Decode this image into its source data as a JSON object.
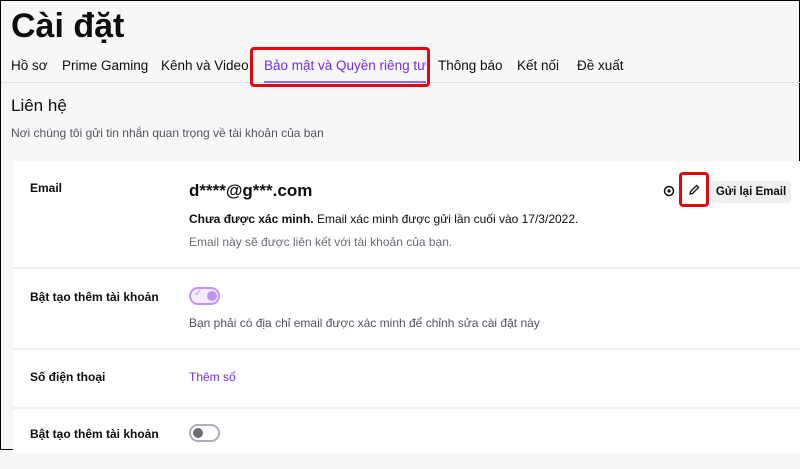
{
  "header": {
    "title": "Cài đặt"
  },
  "tabs": [
    {
      "label": "Hồ sơ"
    },
    {
      "label": "Prime Gaming"
    },
    {
      "label": "Kênh và Video"
    },
    {
      "label": "Bảo mật và Quyền riêng tư"
    },
    {
      "label": "Thông báo"
    },
    {
      "label": "Kết nối"
    },
    {
      "label": "Đề xuất"
    }
  ],
  "section": {
    "title": "Liên hệ",
    "subtitle": "Nơi chúng tôi gửi tin nhắn quan trọng về tài khoản của bạn"
  },
  "email": {
    "label": "Email",
    "value": "d****@g***.com",
    "status_bold": "Chưa được xác minh.",
    "status_rest": " Email xác minh được gửi lần cuối vào 17/3/2022.",
    "note": "Email này sẽ được liên kết với tài khoản của bạn.",
    "resend_label": "Gửi lại Email"
  },
  "toggle1": {
    "label": "Bật tạo thêm tài khoản",
    "on": true,
    "note": "Bạn phải có địa chỉ email được xác minh để chỉnh sửa cài đặt này"
  },
  "phone": {
    "label": "Số điện thoại",
    "add_label": "Thêm số"
  },
  "toggle2": {
    "label": "Bật tạo thêm tài khoản",
    "on": false
  },
  "colors": {
    "accent": "#772ce8",
    "highlight": "#e3060f"
  }
}
